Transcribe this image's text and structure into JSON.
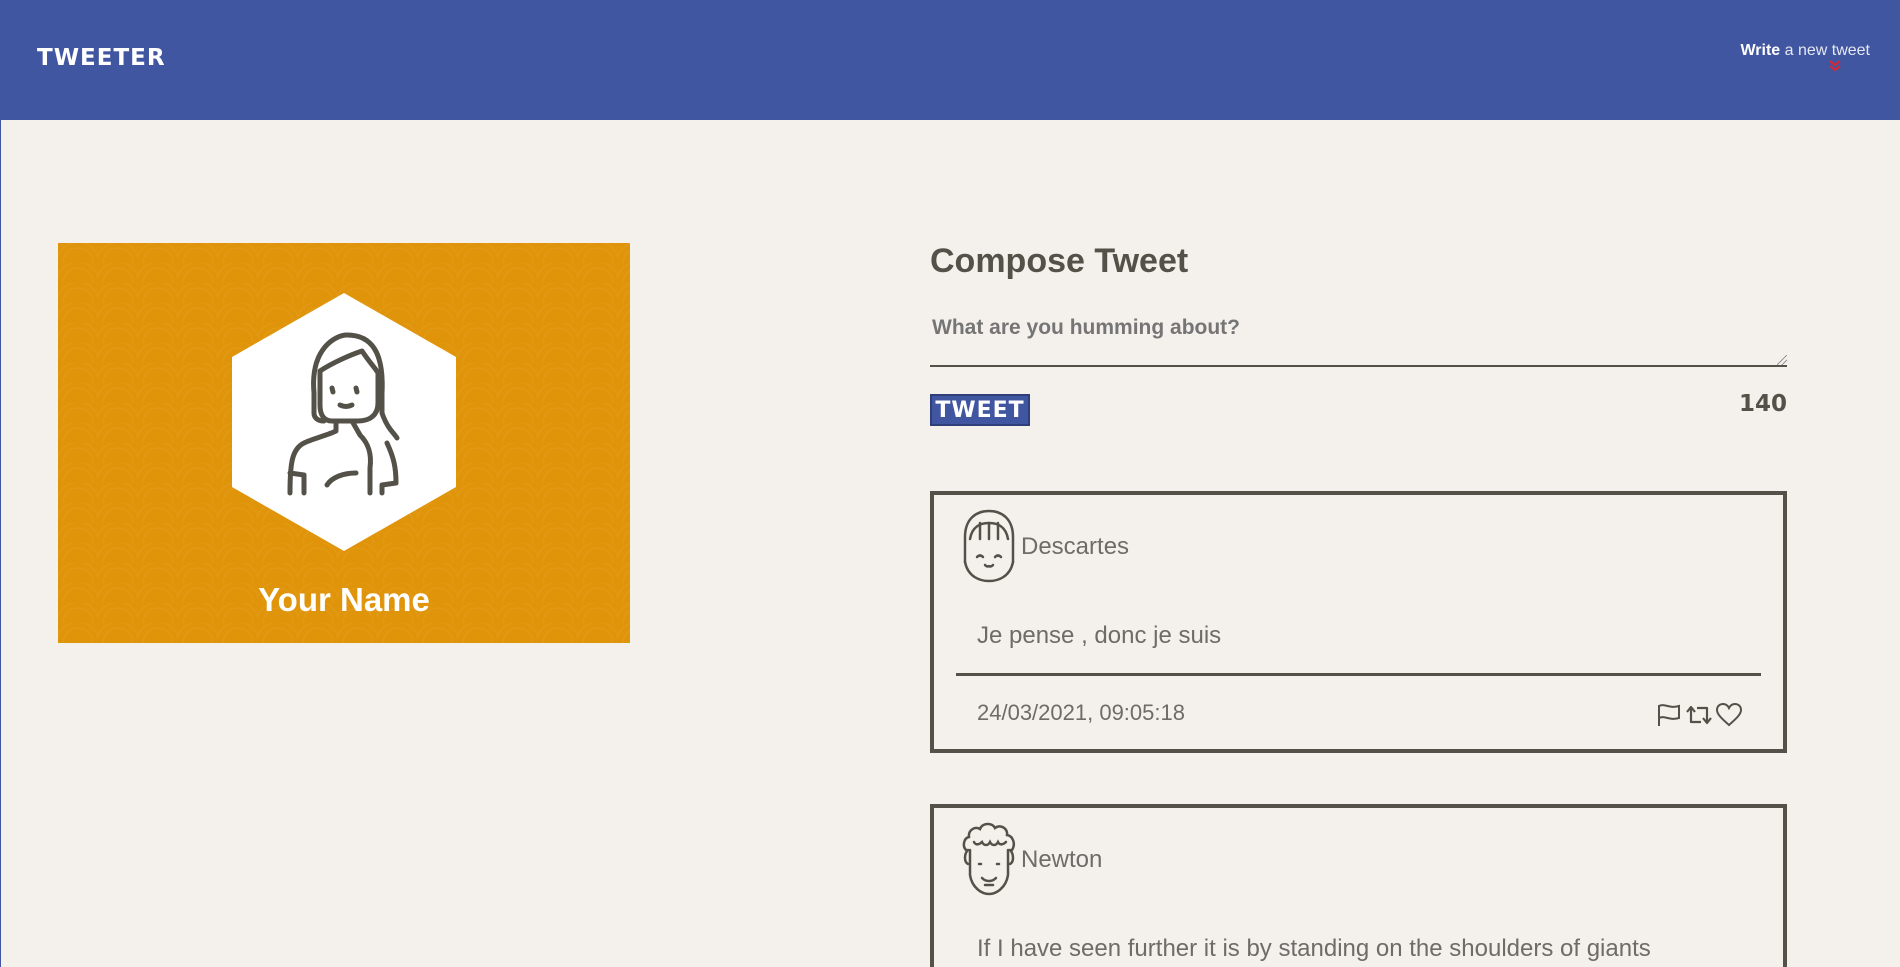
{
  "nav": {
    "brand": "TWEETER",
    "write_bold": "Write",
    "write_rest": " a new tweet",
    "write_arrow": "»"
  },
  "profile": {
    "name": "Your Name",
    "avatar_icon": "woman-avatar-icon"
  },
  "compose": {
    "title": "Compose Tweet",
    "placeholder": "What are you humming about?",
    "button_label": "TWEET",
    "counter": "140"
  },
  "tweets": [
    {
      "author": "Descartes",
      "text": "Je pense , donc je suis",
      "date": "24/03/2021, 09:05:18",
      "avatar_icon": "girl-avatar-icon",
      "actions": [
        "flag-icon",
        "retweet-icon",
        "heart-icon"
      ]
    },
    {
      "author": "Newton",
      "text": "If I have seen further it is by standing on the shoulders of giants",
      "avatar_icon": "curly-hair-avatar-icon"
    }
  ],
  "colors": {
    "nav_bg": "#4056a1",
    "page_bg": "#f4f1ec",
    "profile_bg": "#e0940a",
    "text_dark": "#545149",
    "accent_red": "#e0252f"
  }
}
